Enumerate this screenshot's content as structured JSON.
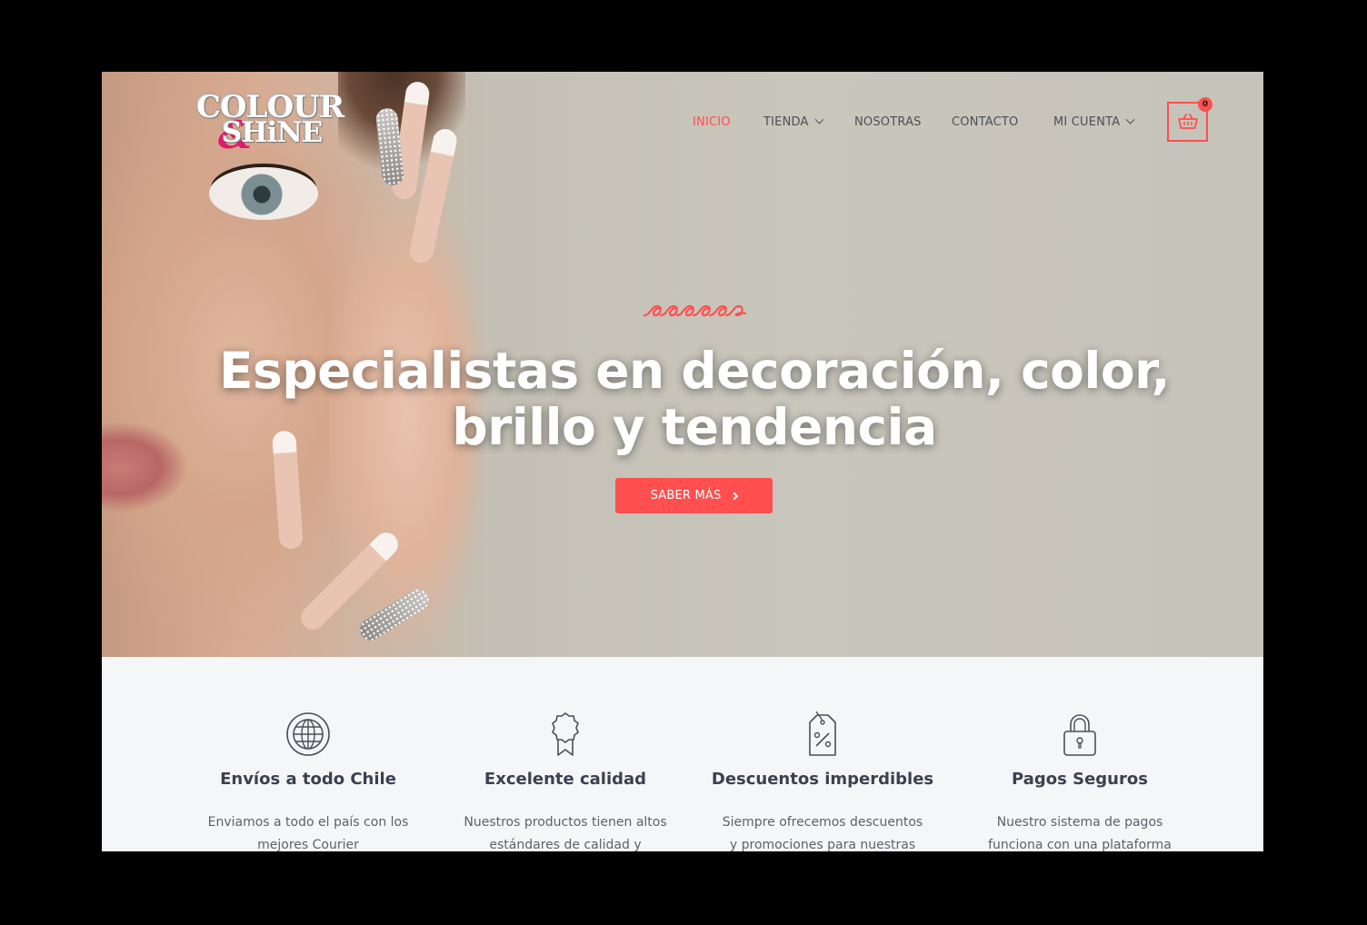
{
  "brand": {
    "line1": "COLOUR",
    "amp": "&",
    "line2": "SHiNE"
  },
  "nav": {
    "items": [
      {
        "label": "INICIO",
        "active": true,
        "dropdown": false
      },
      {
        "label": "TIENDA",
        "active": false,
        "dropdown": true
      },
      {
        "label": "NOSOTRAS",
        "active": false,
        "dropdown": false
      },
      {
        "label": "CONTACTO",
        "active": false,
        "dropdown": false
      },
      {
        "label": "MI CUENTA",
        "active": false,
        "dropdown": true
      }
    ],
    "cart_count": "0"
  },
  "hero": {
    "title_line1": "Especialistas en decoración, color,",
    "title_line2": "brillo y tendencia",
    "cta_label": "SABER MÁS"
  },
  "features": [
    {
      "icon": "globe-icon",
      "title": "Envíos a todo Chile",
      "text_line1": "Enviamos a todo el país con los",
      "text_line2": "mejores Courier"
    },
    {
      "icon": "award-ribbon-icon",
      "title": "Excelente calidad",
      "text_line1": "Nuestros productos tienen altos",
      "text_line2": "estándares de calidad y"
    },
    {
      "icon": "discount-tag-icon",
      "title": "Descuentos imperdibles",
      "text_line1": "Siempre ofrecemos descuentos",
      "text_line2": "y promociones para nuestras"
    },
    {
      "icon": "padlock-icon",
      "title": "Pagos Seguros",
      "text_line1": "Nuestro sistema de pagos",
      "text_line2": "funciona con una plataforma"
    }
  ],
  "colors": {
    "accent": "#ff4f4f",
    "logo_pink": "#e01a6d",
    "text_dark": "#3a4150",
    "text_muted": "#5d6169",
    "nav_text": "#4b4f58"
  }
}
